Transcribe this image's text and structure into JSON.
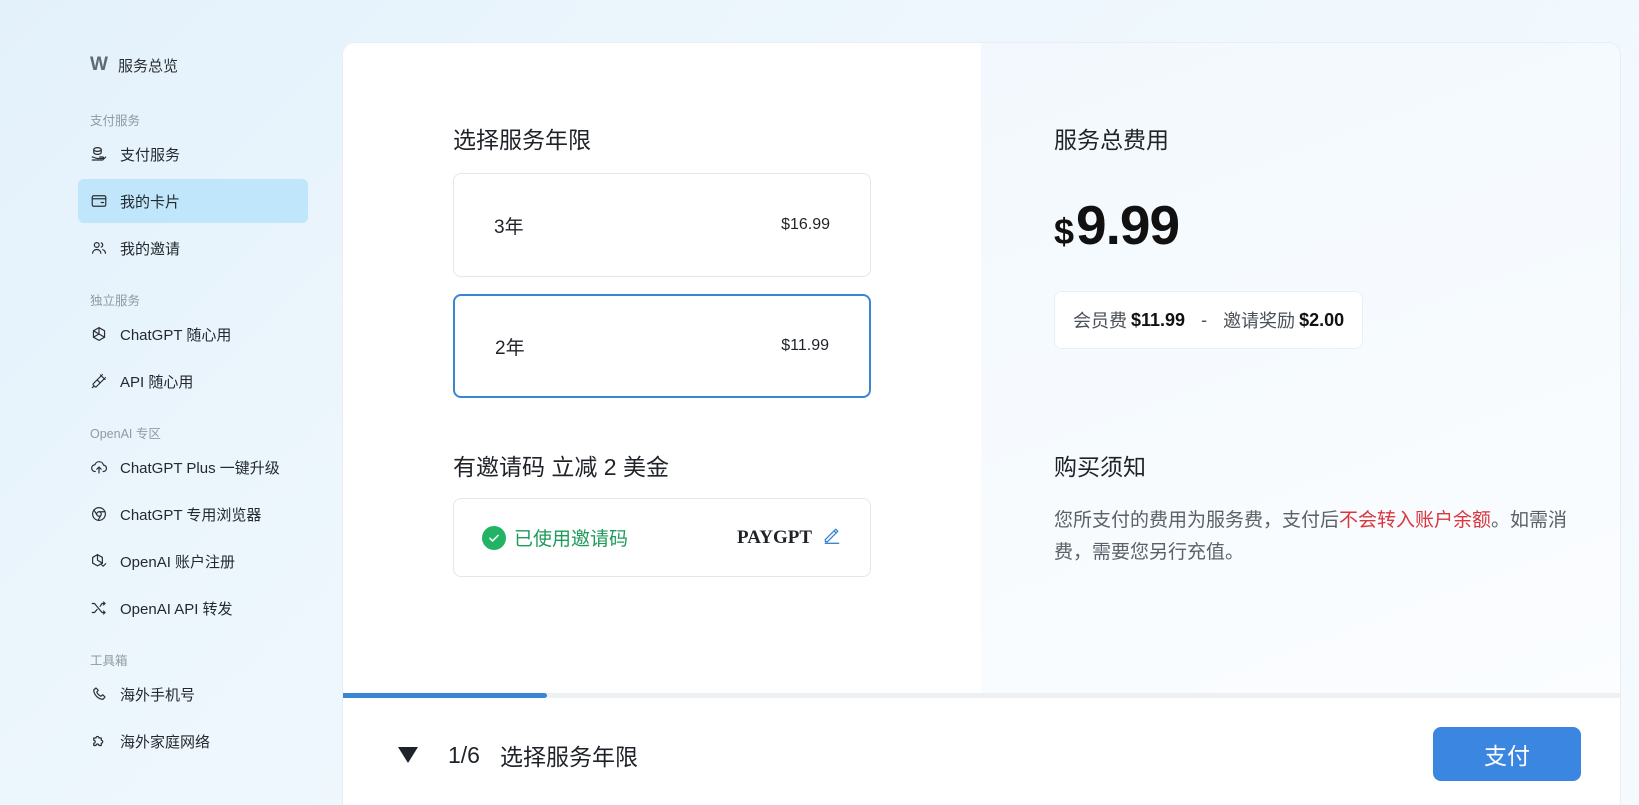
{
  "sidebar": {
    "brand_logo": "W",
    "brand_name": "服务总览",
    "sections": [
      {
        "title": "支付服务",
        "items": [
          {
            "label": "支付服务",
            "icon": "coin-stack-icon",
            "active": false
          },
          {
            "label": "我的卡片",
            "icon": "wallet-icon",
            "active": true
          },
          {
            "label": "我的邀请",
            "icon": "users-icon",
            "active": false
          }
        ]
      },
      {
        "title": "独立服务",
        "items": [
          {
            "label": "ChatGPT 随心用",
            "icon": "openai-icon",
            "active": false
          },
          {
            "label": "API 随心用",
            "icon": "plug-icon",
            "active": false
          }
        ]
      },
      {
        "title": "OpenAI 专区",
        "items": [
          {
            "label": "ChatGPT Plus 一键升级",
            "icon": "cloud-upload-icon",
            "active": false
          },
          {
            "label": "ChatGPT 专用浏览器",
            "icon": "browser-icon",
            "active": false
          },
          {
            "label": "OpenAI 账户注册",
            "icon": "openai-register-icon",
            "active": false
          },
          {
            "label": "OpenAI API 转发",
            "icon": "shuffle-icon",
            "active": false
          }
        ]
      },
      {
        "title": "工具箱",
        "items": [
          {
            "label": "海外手机号",
            "icon": "phone-icon",
            "active": false
          },
          {
            "label": "海外家庭网络",
            "icon": "puzzle-icon",
            "active": false
          }
        ]
      }
    ]
  },
  "plan": {
    "title": "选择服务年限",
    "options": [
      {
        "years": "3年",
        "price": "$16.99",
        "selected": false
      },
      {
        "years": "2年",
        "price": "$11.99",
        "selected": true
      }
    ]
  },
  "invite": {
    "title": "有邀请码 立减 2 美金",
    "status": "已使用邀请码",
    "code": "PAYGPT"
  },
  "summary": {
    "title": "服务总费用",
    "currency": "$",
    "total": "9.99",
    "member_label": "会员费",
    "member_fee": "$11.99",
    "separator": "-",
    "reward_label": "邀请奖励",
    "reward": "$2.00"
  },
  "notice": {
    "title": "购买须知",
    "text_before": "您所支付的费用为服务费，支付后",
    "text_warn": "不会转入账户余额",
    "text_after": "。如需消费，需要您另行充值。"
  },
  "footer": {
    "step": "1/6",
    "step_label": "选择服务年限",
    "progress_fraction": 0.16,
    "pay_label": "支付"
  },
  "colors": {
    "accent": "#3a86d4",
    "active_nav": "#bfe6fb",
    "success": "#22b464",
    "warn": "#d9363e"
  }
}
